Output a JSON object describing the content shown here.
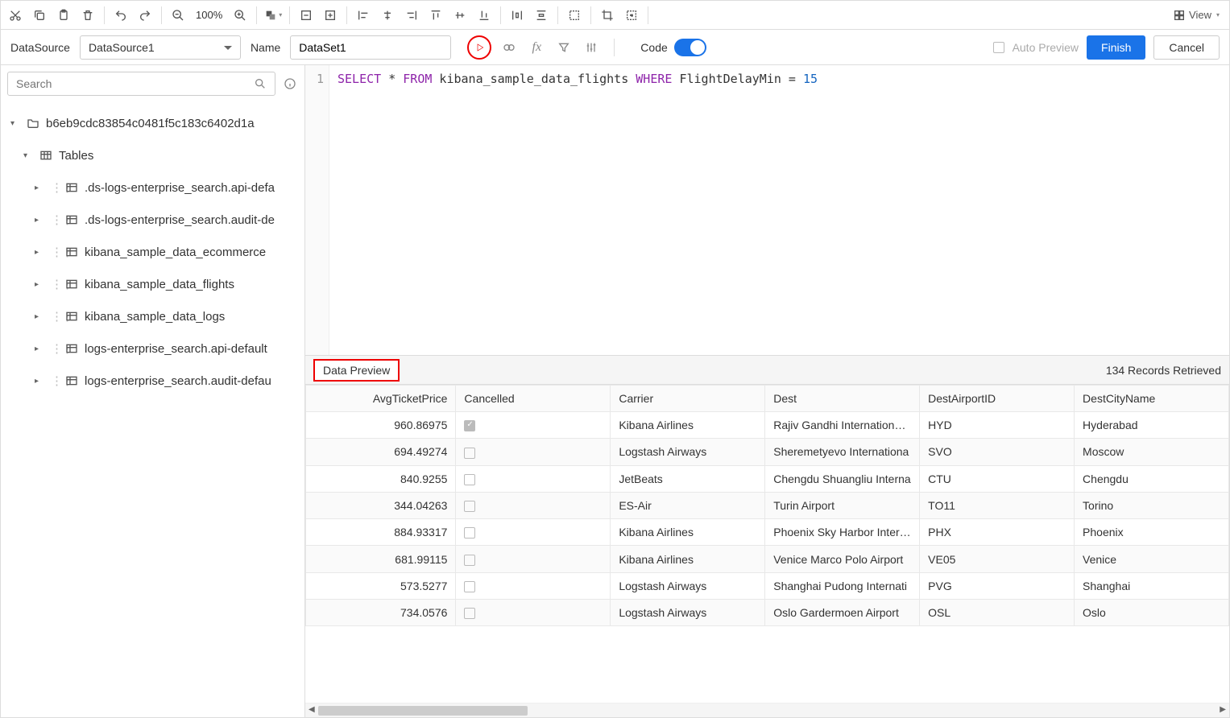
{
  "toolbar": {
    "zoom": "100%",
    "view": "View"
  },
  "subbar": {
    "datasource_label": "DataSource",
    "datasource_value": "DataSource1",
    "name_label": "Name",
    "name_value": "DataSet1",
    "code_label": "Code",
    "auto_preview_label": "Auto Preview",
    "finish_label": "Finish",
    "cancel_label": "Cancel"
  },
  "search": {
    "placeholder": "Search"
  },
  "tree": {
    "root": "b6eb9cdc83854c0481f5c183c6402d1a",
    "tables_label": "Tables",
    "items": [
      ".ds-logs-enterprise_search.api-defa",
      ".ds-logs-enterprise_search.audit-de",
      "kibana_sample_data_ecommerce",
      "kibana_sample_data_flights",
      "kibana_sample_data_logs",
      "logs-enterprise_search.api-default",
      "logs-enterprise_search.audit-defau"
    ]
  },
  "editor": {
    "line_no": "1",
    "tokens": [
      "SELECT",
      " * ",
      "FROM",
      " kibana_sample_data_flights ",
      "WHERE",
      " FlightDelayMin = ",
      "15"
    ]
  },
  "preview": {
    "tab": "Data Preview",
    "count": "134 Records Retrieved",
    "columns": [
      "AvgTicketPrice",
      "Cancelled",
      "Carrier",
      "Dest",
      "DestAirportID",
      "DestCityName"
    ],
    "rows": [
      {
        "price": "960.86975",
        "cancelled": true,
        "carrier": "Kibana Airlines",
        "dest": "Rajiv Gandhi International A",
        "daid": "HYD",
        "dcn": "Hyderabad"
      },
      {
        "price": "694.49274",
        "cancelled": false,
        "carrier": "Logstash Airways",
        "dest": "Sheremetyevo Internationa",
        "daid": "SVO",
        "dcn": "Moscow"
      },
      {
        "price": "840.9255",
        "cancelled": false,
        "carrier": "JetBeats",
        "dest": "Chengdu Shuangliu Interna",
        "daid": "CTU",
        "dcn": "Chengdu"
      },
      {
        "price": "344.04263",
        "cancelled": false,
        "carrier": "ES-Air",
        "dest": "Turin Airport",
        "daid": "TO11",
        "dcn": "Torino"
      },
      {
        "price": "884.93317",
        "cancelled": false,
        "carrier": "Kibana Airlines",
        "dest": "Phoenix Sky Harbor Interna",
        "daid": "PHX",
        "dcn": "Phoenix"
      },
      {
        "price": "681.99115",
        "cancelled": false,
        "carrier": "Kibana Airlines",
        "dest": "Venice Marco Polo Airport",
        "daid": "VE05",
        "dcn": "Venice"
      },
      {
        "price": "573.5277",
        "cancelled": false,
        "carrier": "Logstash Airways",
        "dest": "Shanghai Pudong Internati",
        "daid": "PVG",
        "dcn": "Shanghai"
      },
      {
        "price": "734.0576",
        "cancelled": false,
        "carrier": "Logstash Airways",
        "dest": "Oslo Gardermoen Airport",
        "daid": "OSL",
        "dcn": "Oslo"
      }
    ]
  }
}
